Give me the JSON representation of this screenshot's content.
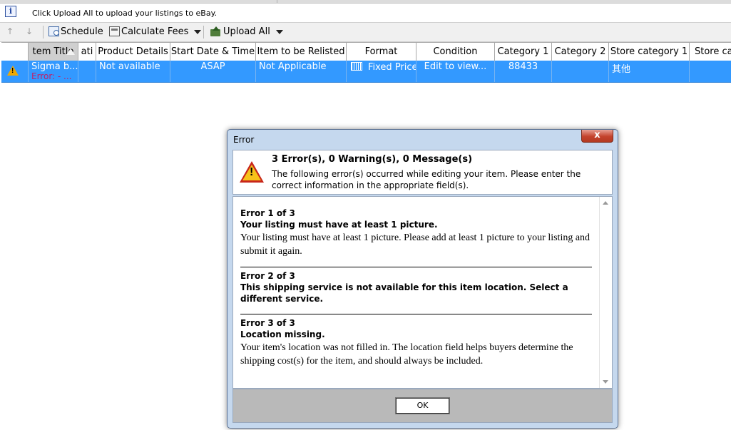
{
  "infobar": {
    "text": "Click Upload All to upload your listings to eBay."
  },
  "toolbar": {
    "schedule_label": "Schedule",
    "calculate_fees_label": "Calculate Fees",
    "upload_all_label": "Upload All"
  },
  "grid": {
    "columns": [
      "tem Title",
      "ati",
      "Product Details",
      "Start Date & Time",
      "Item to be Relisted",
      "Format",
      "Condition",
      "Category 1",
      "Category 2",
      "Store category 1",
      "Store cat"
    ],
    "row": {
      "title": "Sigma b...",
      "title_error": "Error: - ...",
      "product_details": "Not available",
      "start_date": "ASAP",
      "relisted": "Not Applicable",
      "format": "Fixed Price",
      "condition": "Edit to view...",
      "category1": "88433",
      "category2": "",
      "store_category1": "其他",
      "store_cat": ""
    }
  },
  "dialog": {
    "title": "Error",
    "summary": "3 Error(s), 0 Warning(s), 0 Message(s)",
    "message": "The following error(s) occurred while editing your item. Please enter the correct information in the appropriate field(s).",
    "errors": [
      {
        "heading": "Error 1 of 3",
        "title": "Your listing must have at least 1 picture.",
        "detail": "Your listing must have at least 1 picture. Please add at least 1 picture to your listing and submit it again."
      },
      {
        "heading": "Error 2 of 3",
        "title": "This shipping service is not available for this item location. Select a different service.",
        "detail": ""
      },
      {
        "heading": "Error 3 of 3",
        "title": "Location missing.",
        "detail": "Your item's location was not filled in. The location field helps buyers determine the shipping cost(s) for the item, and should always be included."
      }
    ],
    "ok_label": "OK",
    "close_glyph": "x"
  }
}
